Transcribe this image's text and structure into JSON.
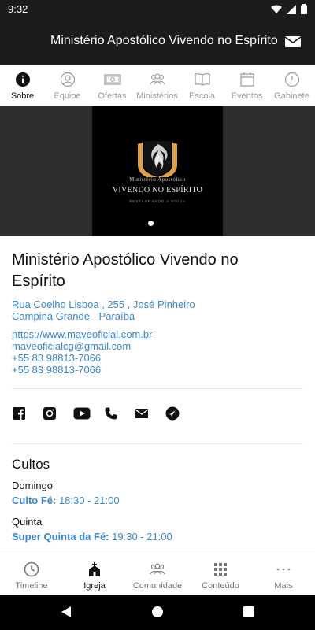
{
  "status": {
    "time": "9:32"
  },
  "app_bar": {
    "title": "Ministério Apostólico Vivendo no Espírito"
  },
  "tabs": [
    {
      "label": "Sobre",
      "icon": "info-icon",
      "active": true
    },
    {
      "label": "Equipe",
      "icon": "user-icon"
    },
    {
      "label": "Ofertas",
      "icon": "money-icon"
    },
    {
      "label": "Ministérios",
      "icon": "group-icon"
    },
    {
      "label": "Escola",
      "icon": "book-icon"
    },
    {
      "label": "Eventos",
      "icon": "calendar-icon"
    },
    {
      "label": "Gabinete",
      "icon": "clock-icon"
    }
  ],
  "hero": {
    "logo_line1": "Ministério Apostólico",
    "logo_line2": "VIVENDO NO ESPÍRITO",
    "logo_line3": "RESTAURANDO A NOIVA"
  },
  "church": {
    "name": "Ministério Apostólico Vivendo no Espírito",
    "address_line1": "Rua Coelho Lisboa , 255 , José Pinheiro",
    "address_line2": "Campina Grande - Paraíba",
    "website": "https://www.maveoficial.com.br",
    "email": "maveoficialcg@gmail.com",
    "phone1": "+55 83 98813-7066",
    "phone2": "+55 83 98813-7066"
  },
  "social_icons": [
    "facebook-icon",
    "instagram-icon",
    "youtube-icon",
    "phone-icon",
    "mail-icon",
    "navigation-icon"
  ],
  "cultos": {
    "title": "Cultos",
    "days": [
      {
        "day": "Domingo",
        "name": "Culto Fé:",
        "time": "18:30 - 21:00"
      },
      {
        "day": "Quinta",
        "name": "Super Quinta da Fé:",
        "time": "19:30 - 21:00"
      }
    ]
  },
  "bottom_nav": [
    {
      "label": "Timeline",
      "icon": "clock-icon"
    },
    {
      "label": "Igreja",
      "icon": "church-icon",
      "active": true
    },
    {
      "label": "Comunidade",
      "icon": "community-icon"
    },
    {
      "label": "Conteúdo",
      "icon": "grid-icon"
    },
    {
      "label": "Mais",
      "icon": "more-icon"
    }
  ],
  "colors": {
    "accent": "#3b87c9",
    "bar": "#1c1c1c",
    "logo_gold": "#e0a04a"
  }
}
